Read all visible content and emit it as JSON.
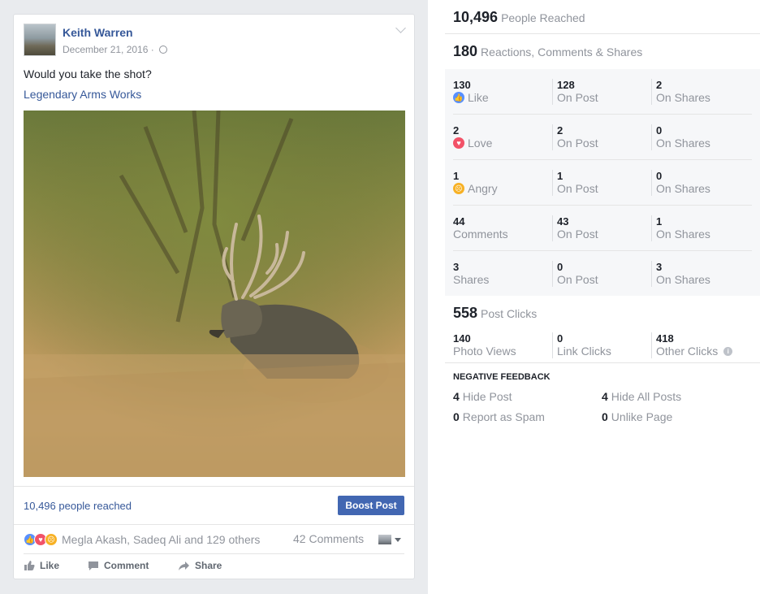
{
  "post": {
    "author": "Keith Warren",
    "date": "December 21, 2016 ·",
    "text": "Would you take the shot?",
    "link": "Legendary Arms Works",
    "reached_link": "10,496 people reached",
    "boost_label": "Boost Post",
    "reaction_names": "Megla Akash, Sadeq Ali and 129 others",
    "comments_count": "42 Comments",
    "actions": {
      "like": "Like",
      "comment": "Comment",
      "share": "Share"
    }
  },
  "stats": {
    "people_reached": {
      "value": "10,496",
      "label": "People Reached"
    },
    "engagement": {
      "value": "180",
      "label": "Reactions, Comments & Shares"
    },
    "rows": [
      {
        "total": "130",
        "label": "Like",
        "icon": "like-icon",
        "on_post": "128",
        "on_post_label": "On Post",
        "on_shares": "2",
        "on_shares_label": "On Shares"
      },
      {
        "total": "2",
        "label": "Love",
        "icon": "love-icon",
        "on_post": "2",
        "on_post_label": "On Post",
        "on_shares": "0",
        "on_shares_label": "On Shares"
      },
      {
        "total": "1",
        "label": "Angry",
        "icon": "angry-icon",
        "on_post": "1",
        "on_post_label": "On Post",
        "on_shares": "0",
        "on_shares_label": "On Shares"
      },
      {
        "total": "44",
        "label": "Comments",
        "icon": "",
        "on_post": "43",
        "on_post_label": "On Post",
        "on_shares": "1",
        "on_shares_label": "On Shares"
      },
      {
        "total": "3",
        "label": "Shares",
        "icon": "",
        "on_post": "0",
        "on_post_label": "On Post",
        "on_shares": "3",
        "on_shares_label": "On Shares"
      }
    ],
    "post_clicks": {
      "value": "558",
      "label": "Post Clicks"
    },
    "clicks": [
      {
        "value": "140",
        "label": "Photo Views"
      },
      {
        "value": "0",
        "label": "Link Clicks"
      },
      {
        "value": "418",
        "label": "Other Clicks"
      }
    ],
    "negative": {
      "title": "NEGATIVE FEEDBACK",
      "items": [
        {
          "value": "4",
          "label": "Hide Post"
        },
        {
          "value": "4",
          "label": "Hide All Posts"
        },
        {
          "value": "0",
          "label": "Report as Spam"
        },
        {
          "value": "0",
          "label": "Unlike Page"
        }
      ]
    }
  },
  "colors": {
    "link": "#365899",
    "boost": "#4267b2",
    "muted": "#90949c",
    "like": "#5890ff",
    "love": "#f25268",
    "angry": "#f7b125"
  }
}
